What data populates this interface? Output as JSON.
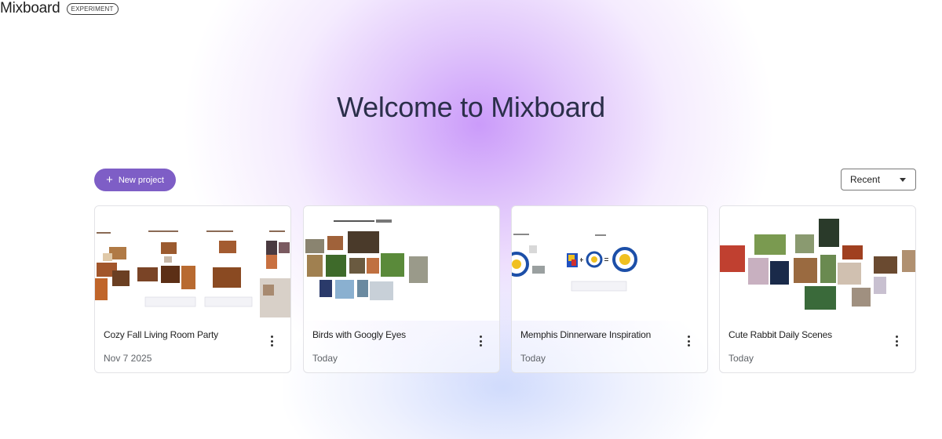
{
  "header": {
    "title": "Mixboard",
    "badge": "EXPERIMENT"
  },
  "hero": {
    "title": "Welcome to Mixboard"
  },
  "toolbar": {
    "new_project_label": "New project",
    "sort_value": "Recent"
  },
  "projects": [
    {
      "title": "Cozy Fall Living Room Party",
      "date": "Nov 7 2025"
    },
    {
      "title": "Birds with Googly Eyes",
      "date": "Today"
    },
    {
      "title": "Memphis Dinnerware Inspiration",
      "date": "Today"
    },
    {
      "title": "Cute Rabbit Daily Scenes",
      "date": "Today"
    }
  ],
  "colors": {
    "accent": "#7e5ec6",
    "heading": "#2b2f4a",
    "glow": "#c896fa"
  },
  "icons": {
    "new_project": "plus-icon",
    "sort": "chevron-down-icon",
    "card_menu": "more-vert-icon"
  }
}
